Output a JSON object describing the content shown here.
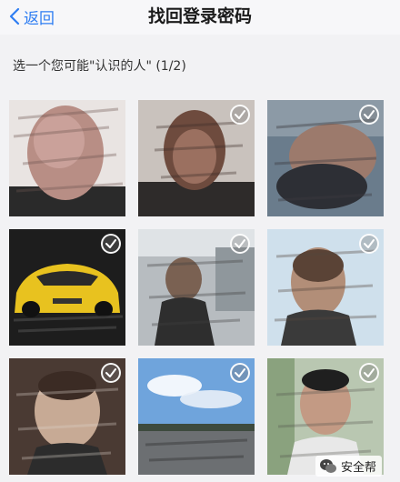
{
  "nav": {
    "back_label": "返回",
    "title": "找回登录密码"
  },
  "prompt": "选一个您可能\"认识的人\" (1/2)",
  "photos": [
    {
      "subject": "blurred face photo",
      "checked": false
    },
    {
      "subject": "blurred face photo",
      "checked": true
    },
    {
      "subject": "blurred face photo",
      "checked": true
    },
    {
      "subject": "yellow sports car",
      "checked": true
    },
    {
      "subject": "blurred person at station",
      "checked": true
    },
    {
      "subject": "blurred face photo",
      "checked": true
    },
    {
      "subject": "blurred face photo",
      "checked": true
    },
    {
      "subject": "sky and road scene",
      "checked": true
    },
    {
      "subject": "blurred man photo",
      "checked": true
    }
  ],
  "watermark": {
    "text": "安全帮",
    "icon": "wechat-logo-icon"
  },
  "colors": {
    "accent": "#2f7ef2",
    "background": "#f2f2f4"
  }
}
